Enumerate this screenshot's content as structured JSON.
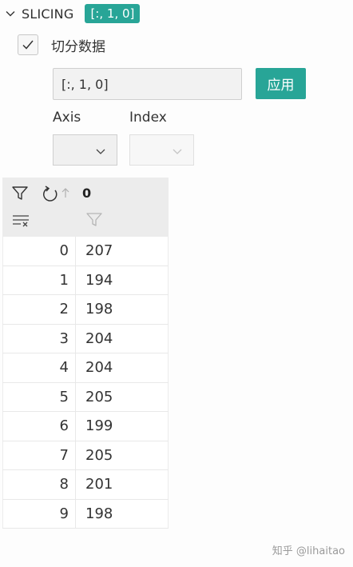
{
  "section": {
    "title": "SLICING",
    "badge": "[:, 1, 0]"
  },
  "checkbox": {
    "label": "切分数据",
    "checked": true
  },
  "slice_input": {
    "value": "[:, 1, 0]"
  },
  "apply_button": {
    "label": "应用"
  },
  "axis": {
    "label": "Axis",
    "value": ""
  },
  "index": {
    "label": "Index",
    "value": ""
  },
  "table": {
    "column_header": "0",
    "rows": [
      {
        "index": "0",
        "value": "207"
      },
      {
        "index": "1",
        "value": "194"
      },
      {
        "index": "2",
        "value": "198"
      },
      {
        "index": "3",
        "value": "204"
      },
      {
        "index": "4",
        "value": "204"
      },
      {
        "index": "5",
        "value": "205"
      },
      {
        "index": "6",
        "value": "199"
      },
      {
        "index": "7",
        "value": "205"
      },
      {
        "index": "8",
        "value": "201"
      },
      {
        "index": "9",
        "value": "198"
      }
    ]
  },
  "watermark": {
    "text": "知乎 @lihaitao"
  },
  "colors": {
    "accent": "#28a597",
    "header_bg": "#ececec"
  },
  "icons": [
    "chevron-down-icon",
    "checkmark-icon",
    "filter-icon",
    "refresh-icon",
    "sort-up-icon",
    "clear-filter-icon",
    "column-filter-icon"
  ]
}
